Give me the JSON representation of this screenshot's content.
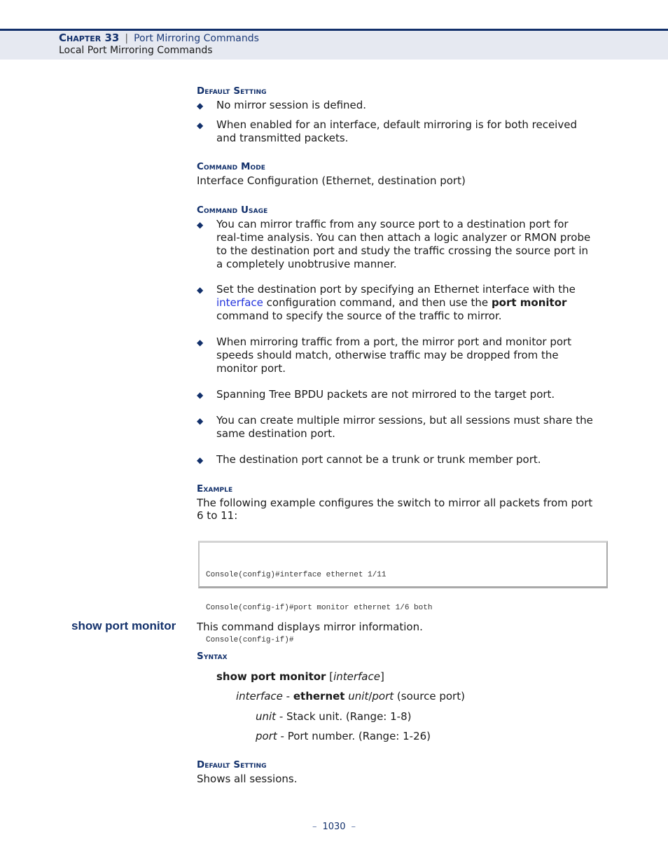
{
  "header": {
    "chapter_label": "Chapter 33",
    "separator": "|",
    "chapter_title": "Port Mirroring Commands",
    "section_title": "Local Port Mirroring Commands"
  },
  "default_setting_1": {
    "heading": "Default Setting",
    "bullets": [
      {
        "lines": [
          "No mirror session is defined."
        ]
      },
      {
        "lines": [
          "When enabled for an interface, default mirroring is for both received",
          "and transmitted packets."
        ]
      }
    ]
  },
  "command_mode": {
    "heading": "Command Mode",
    "text": "Interface Configuration (Ethernet, destination port)"
  },
  "command_usage": {
    "heading": "Command Usage",
    "bullet1": [
      "You can mirror traffic from any source port to a destination port for",
      "real-time analysis. You can then attach a logic analyzer or RMON probe",
      "to the destination port and study the traffic crossing the source port in",
      "a completely unobtrusive manner."
    ],
    "bullet2": {
      "line1": "Set the destination port by specifying an Ethernet interface with the",
      "link": "interface",
      "line2_mid": " configuration command, and then use the ",
      "line2_bold": "port monitor",
      "line3": "command to specify the source of the traffic to mirror."
    },
    "bullet3": [
      "When mirroring traffic from a port, the mirror port and monitor port",
      "speeds should match, otherwise traffic may be dropped from the",
      "monitor port."
    ],
    "bullet4": [
      "Spanning Tree BPDU packets are not mirrored to the target port."
    ],
    "bullet5": [
      "You can create multiple mirror sessions, but all sessions must share the",
      "same destination port."
    ],
    "bullet6": [
      "The destination port cannot be a trunk or trunk member port."
    ]
  },
  "example": {
    "heading": "Example",
    "lines": [
      "The following example configures the switch to mirror all packets from port",
      "6 to 11:"
    ],
    "code": [
      "Console(config)#interface ethernet 1/11",
      "Console(config-if)#port monitor ethernet 1/6 both",
      "Console(config-if)#"
    ]
  },
  "show_port_monitor": {
    "title": "show port monitor",
    "description": "This command displays mirror information.",
    "syntax_heading": "Syntax",
    "syntax": {
      "cmd": "show port monitor",
      "open": " [",
      "arg": "interface",
      "close": "]"
    },
    "param": {
      "name": "interface",
      "dash": " - ",
      "kw": "ethernet",
      "sp": " ",
      "unit": "unit",
      "slash": "/",
      "port": "port",
      "desc": " (source port)"
    },
    "unit": {
      "name": "unit",
      "desc": " - Stack unit. (Range: 1-8)"
    },
    "port": {
      "name": "port",
      "desc": " - Port number. (Range: 1-26)"
    },
    "default_heading": "Default Setting",
    "default_text": "Shows all sessions."
  },
  "footer": {
    "dash": "–",
    "page_number": "1030"
  },
  "icons": {
    "bullet": "◆"
  }
}
